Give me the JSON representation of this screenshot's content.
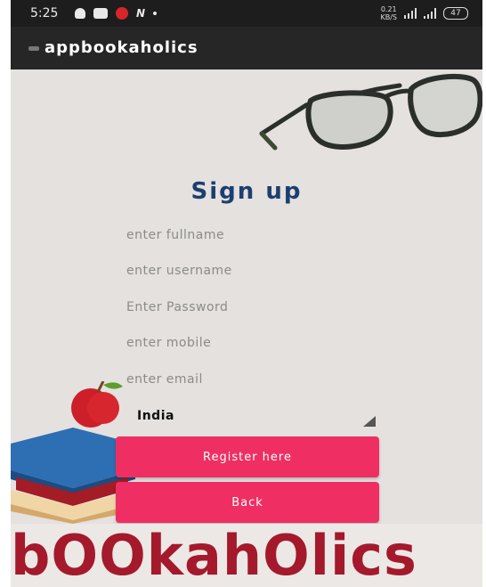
{
  "status_bar": {
    "time": "5:25",
    "net_speed_top": "0.21",
    "net_speed_bottom": "KB/S",
    "battery": "47"
  },
  "app_bar": {
    "title": "appbookaholics"
  },
  "page": {
    "title": "Sign up"
  },
  "form": {
    "fullname_placeholder": "enter fullname",
    "username_placeholder": "enter username",
    "password_placeholder": "Enter Password",
    "mobile_placeholder": "enter mobile",
    "email_placeholder": "enter email",
    "country_value": "India"
  },
  "buttons": {
    "register_label": "Register here",
    "back_label": "Back"
  },
  "logo_text": "bOOkahOlics",
  "colors": {
    "accent": "#ef2f63",
    "title": "#1c3f70",
    "logo": "#a4192b",
    "app_bar": "#262626"
  },
  "icons": [
    "snapchat-icon",
    "youtube-icon",
    "jio-icon",
    "n-icon",
    "signal-icon",
    "battery-icon"
  ]
}
